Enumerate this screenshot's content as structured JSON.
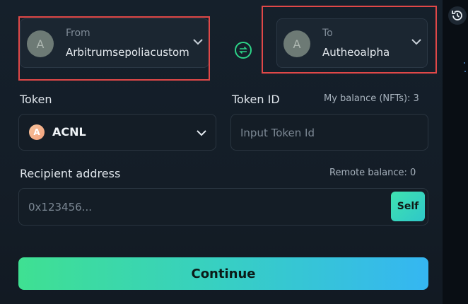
{
  "from": {
    "label": "From",
    "chain": "Arbitrumsepoliacustom",
    "avatar_letter": "A"
  },
  "to": {
    "label": "To",
    "chain": "Autheoalpha",
    "avatar_letter": "A"
  },
  "token": {
    "label": "Token",
    "selected": "ACNL",
    "icon_letter": "A"
  },
  "token_id": {
    "label": "Token ID",
    "balance": "My balance (NFTs): 3",
    "placeholder": "Input Token Id"
  },
  "recipient": {
    "label": "Recipient address",
    "remote_balance": "Remote balance: 0",
    "placeholder": "0x123456...",
    "self_label": "Self"
  },
  "continue_label": "Continue",
  "colors": {
    "accent_green": "#2dd388",
    "highlight_red": "#e04848",
    "button_gradient_start": "#3fe092",
    "button_gradient_end": "#35b6f2"
  }
}
